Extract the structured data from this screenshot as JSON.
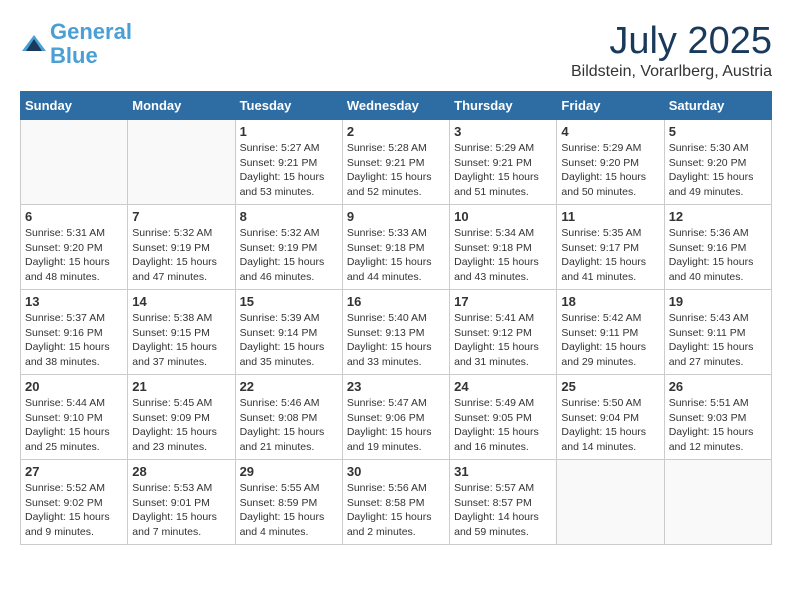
{
  "header": {
    "logo_line1": "General",
    "logo_line2": "Blue",
    "month_year": "July 2025",
    "location": "Bildstein, Vorarlberg, Austria"
  },
  "weekdays": [
    "Sunday",
    "Monday",
    "Tuesday",
    "Wednesday",
    "Thursday",
    "Friday",
    "Saturday"
  ],
  "weeks": [
    [
      {
        "day": "",
        "info": ""
      },
      {
        "day": "",
        "info": ""
      },
      {
        "day": "1",
        "info": "Sunrise: 5:27 AM\nSunset: 9:21 PM\nDaylight: 15 hours\nand 53 minutes."
      },
      {
        "day": "2",
        "info": "Sunrise: 5:28 AM\nSunset: 9:21 PM\nDaylight: 15 hours\nand 52 minutes."
      },
      {
        "day": "3",
        "info": "Sunrise: 5:29 AM\nSunset: 9:21 PM\nDaylight: 15 hours\nand 51 minutes."
      },
      {
        "day": "4",
        "info": "Sunrise: 5:29 AM\nSunset: 9:20 PM\nDaylight: 15 hours\nand 50 minutes."
      },
      {
        "day": "5",
        "info": "Sunrise: 5:30 AM\nSunset: 9:20 PM\nDaylight: 15 hours\nand 49 minutes."
      }
    ],
    [
      {
        "day": "6",
        "info": "Sunrise: 5:31 AM\nSunset: 9:20 PM\nDaylight: 15 hours\nand 48 minutes."
      },
      {
        "day": "7",
        "info": "Sunrise: 5:32 AM\nSunset: 9:19 PM\nDaylight: 15 hours\nand 47 minutes."
      },
      {
        "day": "8",
        "info": "Sunrise: 5:32 AM\nSunset: 9:19 PM\nDaylight: 15 hours\nand 46 minutes."
      },
      {
        "day": "9",
        "info": "Sunrise: 5:33 AM\nSunset: 9:18 PM\nDaylight: 15 hours\nand 44 minutes."
      },
      {
        "day": "10",
        "info": "Sunrise: 5:34 AM\nSunset: 9:18 PM\nDaylight: 15 hours\nand 43 minutes."
      },
      {
        "day": "11",
        "info": "Sunrise: 5:35 AM\nSunset: 9:17 PM\nDaylight: 15 hours\nand 41 minutes."
      },
      {
        "day": "12",
        "info": "Sunrise: 5:36 AM\nSunset: 9:16 PM\nDaylight: 15 hours\nand 40 minutes."
      }
    ],
    [
      {
        "day": "13",
        "info": "Sunrise: 5:37 AM\nSunset: 9:16 PM\nDaylight: 15 hours\nand 38 minutes."
      },
      {
        "day": "14",
        "info": "Sunrise: 5:38 AM\nSunset: 9:15 PM\nDaylight: 15 hours\nand 37 minutes."
      },
      {
        "day": "15",
        "info": "Sunrise: 5:39 AM\nSunset: 9:14 PM\nDaylight: 15 hours\nand 35 minutes."
      },
      {
        "day": "16",
        "info": "Sunrise: 5:40 AM\nSunset: 9:13 PM\nDaylight: 15 hours\nand 33 minutes."
      },
      {
        "day": "17",
        "info": "Sunrise: 5:41 AM\nSunset: 9:12 PM\nDaylight: 15 hours\nand 31 minutes."
      },
      {
        "day": "18",
        "info": "Sunrise: 5:42 AM\nSunset: 9:11 PM\nDaylight: 15 hours\nand 29 minutes."
      },
      {
        "day": "19",
        "info": "Sunrise: 5:43 AM\nSunset: 9:11 PM\nDaylight: 15 hours\nand 27 minutes."
      }
    ],
    [
      {
        "day": "20",
        "info": "Sunrise: 5:44 AM\nSunset: 9:10 PM\nDaylight: 15 hours\nand 25 minutes."
      },
      {
        "day": "21",
        "info": "Sunrise: 5:45 AM\nSunset: 9:09 PM\nDaylight: 15 hours\nand 23 minutes."
      },
      {
        "day": "22",
        "info": "Sunrise: 5:46 AM\nSunset: 9:08 PM\nDaylight: 15 hours\nand 21 minutes."
      },
      {
        "day": "23",
        "info": "Sunrise: 5:47 AM\nSunset: 9:06 PM\nDaylight: 15 hours\nand 19 minutes."
      },
      {
        "day": "24",
        "info": "Sunrise: 5:49 AM\nSunset: 9:05 PM\nDaylight: 15 hours\nand 16 minutes."
      },
      {
        "day": "25",
        "info": "Sunrise: 5:50 AM\nSunset: 9:04 PM\nDaylight: 15 hours\nand 14 minutes."
      },
      {
        "day": "26",
        "info": "Sunrise: 5:51 AM\nSunset: 9:03 PM\nDaylight: 15 hours\nand 12 minutes."
      }
    ],
    [
      {
        "day": "27",
        "info": "Sunrise: 5:52 AM\nSunset: 9:02 PM\nDaylight: 15 hours\nand 9 minutes."
      },
      {
        "day": "28",
        "info": "Sunrise: 5:53 AM\nSunset: 9:01 PM\nDaylight: 15 hours\nand 7 minutes."
      },
      {
        "day": "29",
        "info": "Sunrise: 5:55 AM\nSunset: 8:59 PM\nDaylight: 15 hours\nand 4 minutes."
      },
      {
        "day": "30",
        "info": "Sunrise: 5:56 AM\nSunset: 8:58 PM\nDaylight: 15 hours\nand 2 minutes."
      },
      {
        "day": "31",
        "info": "Sunrise: 5:57 AM\nSunset: 8:57 PM\nDaylight: 14 hours\nand 59 minutes."
      },
      {
        "day": "",
        "info": ""
      },
      {
        "day": "",
        "info": ""
      }
    ]
  ]
}
